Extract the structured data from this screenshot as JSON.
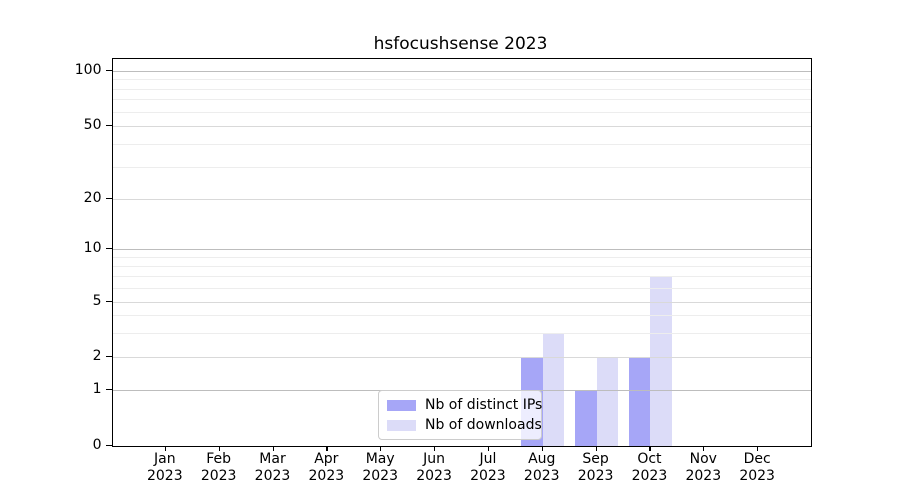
{
  "title": "hsfocushsense 2023",
  "legend": {
    "items": [
      {
        "label": "Nb of distinct IPs",
        "color_key": "distinct_ips"
      },
      {
        "label": "Nb of downloads",
        "color_key": "downloads"
      }
    ]
  },
  "colors": {
    "distinct_ips": "#a6a6f7",
    "downloads": "#dcdcf8",
    "grid_strong": "#bdbdbd",
    "grid_mid": "#d9d9d9",
    "grid_faint": "#ededed",
    "axis": "#000000"
  },
  "chart_data": {
    "type": "bar",
    "title": "hsfocushsense 2023",
    "xlabel": "",
    "ylabel": "",
    "categories": [
      "Jan 2023",
      "Feb 2023",
      "Mar 2023",
      "Apr 2023",
      "May 2023",
      "Jun 2023",
      "Jul 2023",
      "Aug 2023",
      "Sep 2023",
      "Oct 2023",
      "Nov 2023",
      "Dec 2023"
    ],
    "series": [
      {
        "name": "Nb of distinct IPs",
        "values": [
          0,
          0,
          0,
          0,
          0,
          0,
          0,
          2,
          1,
          2,
          0,
          0
        ]
      },
      {
        "name": "Nb of downloads",
        "values": [
          0,
          0,
          0,
          0,
          0,
          0,
          0,
          3,
          2,
          7,
          0,
          0
        ]
      }
    ],
    "yscale": "log-like",
    "yticks": [
      0,
      1,
      2,
      5,
      10,
      20,
      50,
      100
    ],
    "minor_gridlines": [
      3,
      4,
      6,
      7,
      8,
      9,
      30,
      40,
      60,
      70,
      80,
      90
    ],
    "ylim": [
      0,
      115
    ],
    "grid": true,
    "legend_position": "lower center"
  }
}
